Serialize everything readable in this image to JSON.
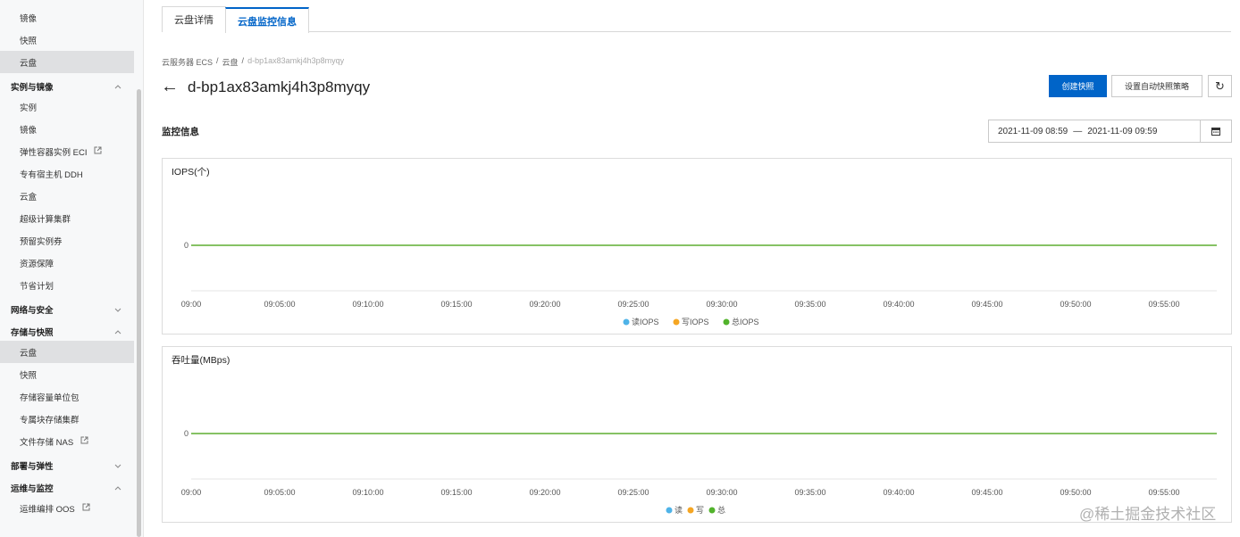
{
  "sidebar": {
    "rows": [
      {
        "label": "镜像",
        "type": "item",
        "active": false
      },
      {
        "label": "快照",
        "type": "item",
        "active": false
      },
      {
        "label": "云盘",
        "type": "item",
        "active": true
      },
      {
        "label": "实例与镜像",
        "type": "group",
        "chevron": "up"
      },
      {
        "label": "实例",
        "type": "item"
      },
      {
        "label": "镜像",
        "type": "item"
      },
      {
        "label": "弹性容器实例 ECI",
        "type": "item",
        "external": true
      },
      {
        "label": "专有宿主机 DDH",
        "type": "item"
      },
      {
        "label": "云盒",
        "type": "item"
      },
      {
        "label": "超级计算集群",
        "type": "item"
      },
      {
        "label": "预留实例券",
        "type": "item"
      },
      {
        "label": "资源保障",
        "type": "item"
      },
      {
        "label": "节省计划",
        "type": "item"
      },
      {
        "label": "网络与安全",
        "type": "group",
        "chevron": "down"
      },
      {
        "label": "存储与快照",
        "type": "group",
        "chevron": "up"
      },
      {
        "label": "云盘",
        "type": "item",
        "active": true
      },
      {
        "label": "快照",
        "type": "item"
      },
      {
        "label": "存储容量单位包",
        "type": "item"
      },
      {
        "label": "专属块存储集群",
        "type": "item"
      },
      {
        "label": "文件存储 NAS",
        "type": "item",
        "external": true
      },
      {
        "label": "部署与弹性",
        "type": "group",
        "chevron": "down"
      },
      {
        "label": "运维与监控",
        "type": "group",
        "chevron": "up"
      },
      {
        "label": "运维编排 OOS",
        "type": "item",
        "external": true
      }
    ]
  },
  "tabs": [
    {
      "label": "云盘详情",
      "active": false
    },
    {
      "label": "云盘监控信息",
      "active": true
    }
  ],
  "breadcrumb": {
    "items": [
      "云服务器 ECS",
      "云盘",
      "d-bp1ax83amkj4h3p8myqy"
    ],
    "separator": "/"
  },
  "page": {
    "title": "d-bp1ax83amkj4h3p8myqy",
    "back_icon": "arrow-left-icon"
  },
  "actions": {
    "create_snapshot": "创建快照",
    "auto_snapshot_policy": "设置自动快照策略",
    "refresh_icon": "refresh-icon"
  },
  "monitor": {
    "section_label": "监控信息",
    "date_start": "2021-11-09 08:59",
    "date_sep": "—",
    "date_end": "2021-11-09 09:59",
    "calendar_icon": "calendar-icon"
  },
  "chart_data": [
    {
      "type": "line",
      "title": "IOPS(个)",
      "x": [
        "09:00",
        "09:05:00",
        "09:10:00",
        "09:15:00",
        "09:20:00",
        "09:25:00",
        "09:30:00",
        "09:35:00",
        "09:40:00",
        "09:45:00",
        "09:50:00",
        "09:55:00"
      ],
      "yticks": [
        "0"
      ],
      "series": [
        {
          "name": "读IOPS",
          "color": "#4fb3e8",
          "values": [
            0,
            0,
            0,
            0,
            0,
            0,
            0,
            0,
            0,
            0,
            0,
            0
          ]
        },
        {
          "name": "写IOPS",
          "color": "#f5a623",
          "values": [
            0,
            0,
            0,
            0,
            0,
            0,
            0,
            0,
            0,
            0,
            0,
            0
          ]
        },
        {
          "name": "总IOPS",
          "color": "#52b32c",
          "values": [
            0,
            0,
            0,
            0,
            0,
            0,
            0,
            0,
            0,
            0,
            0,
            0
          ]
        }
      ],
      "legend_position": "bottom"
    },
    {
      "type": "line",
      "title": "吞吐量(MBps)",
      "x": [
        "09:00",
        "09:05:00",
        "09:10:00",
        "09:15:00",
        "09:20:00",
        "09:25:00",
        "09:30:00",
        "09:35:00",
        "09:40:00",
        "09:45:00",
        "09:50:00",
        "09:55:00"
      ],
      "yticks": [
        "0"
      ],
      "series": [
        {
          "name": "读",
          "color": "#4fb3e8",
          "values": [
            0,
            0,
            0,
            0,
            0,
            0,
            0,
            0,
            0,
            0,
            0,
            0
          ]
        },
        {
          "name": "写",
          "color": "#f5a623",
          "values": [
            0,
            0,
            0,
            0,
            0,
            0,
            0,
            0,
            0,
            0,
            0,
            0
          ]
        },
        {
          "name": "总",
          "color": "#52b32c",
          "values": [
            0,
            0,
            0,
            0,
            0,
            0,
            0,
            0,
            0,
            0,
            0,
            0
          ]
        }
      ],
      "legend_position": "bottom"
    }
  ],
  "watermark": "@稀土掘金技术社区"
}
